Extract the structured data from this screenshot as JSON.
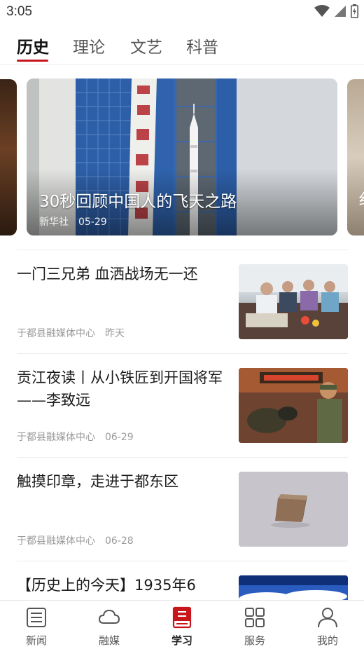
{
  "status_bar": {
    "time": "3:05"
  },
  "tabs": [
    {
      "label": "历史",
      "active": true
    },
    {
      "label": "理论"
    },
    {
      "label": "文艺"
    },
    {
      "label": "科普"
    }
  ],
  "banner": {
    "title": "30秒回顾中国人的飞天之路",
    "source": "新华社",
    "date": "05-29",
    "peek_right_text": "纟"
  },
  "news": [
    {
      "title": "一门三兄弟 血洒战场无一还",
      "source": "于都县融媒体中心",
      "date": "昨天",
      "image": "meeting-photo"
    },
    {
      "title": "贡江夜读丨从小铁匠到开国将军——李致远",
      "source": "于都县融媒体中心",
      "date": "06-29",
      "image": "painting-soldiers"
    },
    {
      "title": "触摸印章，走进于都东区",
      "source": "于都县融媒体中心",
      "date": "06-28",
      "image": "seal-photo"
    },
    {
      "title": "【历史上的今天】1935年6",
      "image": "sky-photo"
    }
  ],
  "bottom_nav": [
    {
      "label": "新闻",
      "icon": "news-list-icon"
    },
    {
      "label": "融媒",
      "icon": "cloud-icon"
    },
    {
      "label": "学习",
      "icon": "book-icon",
      "active": true
    },
    {
      "label": "服务",
      "icon": "grid-icon"
    },
    {
      "label": "我的",
      "icon": "user-icon"
    }
  ],
  "colors": {
    "accent": "#c8161d"
  }
}
